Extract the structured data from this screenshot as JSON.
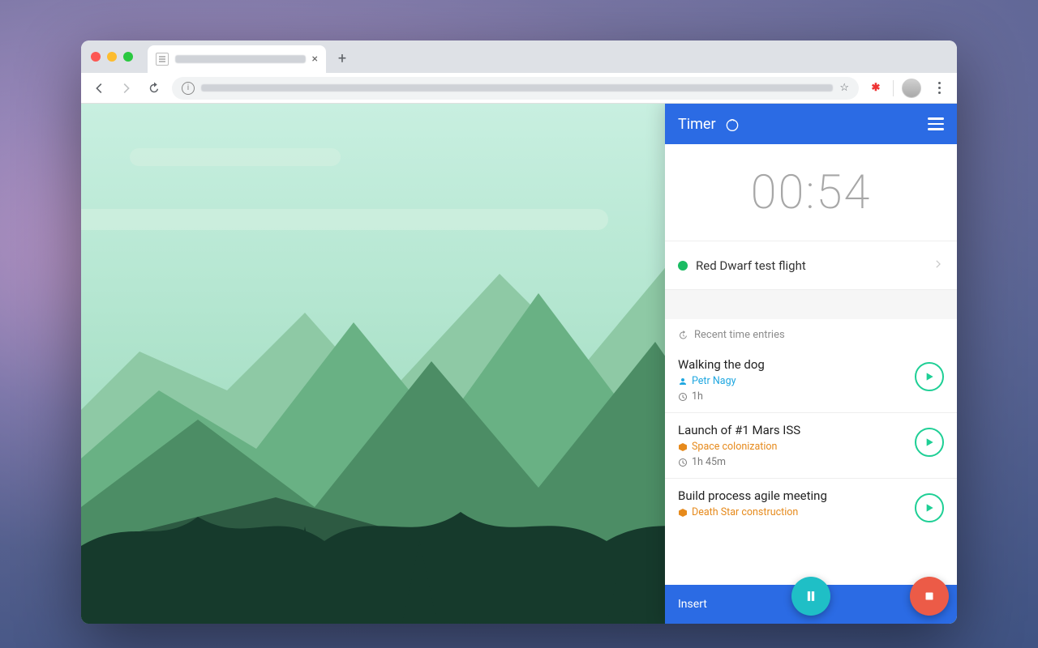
{
  "panel": {
    "title": "Timer",
    "timer_display": "00:54",
    "current_task": {
      "name": "Red Dwarf test flight",
      "status_color": "#1abc63"
    },
    "recent_heading": "Recent time entries",
    "entries": [
      {
        "title": "Walking the dog",
        "tag_type": "user",
        "tag": "Petr Nagy",
        "duration": "1h"
      },
      {
        "title": "Launch of #1 Mars ISS",
        "tag_type": "project",
        "tag": "Space colonization",
        "duration": "1h 45m"
      },
      {
        "title": "Build process agile meeting",
        "tag_type": "project",
        "tag": "Death Star construction",
        "duration": ""
      }
    ],
    "footer_label": "Insert"
  },
  "colors": {
    "brand_blue": "#2b6be4",
    "pause_teal": "#1fbfc6",
    "stop_red": "#ec5b47",
    "play_green": "#1ecf95"
  }
}
